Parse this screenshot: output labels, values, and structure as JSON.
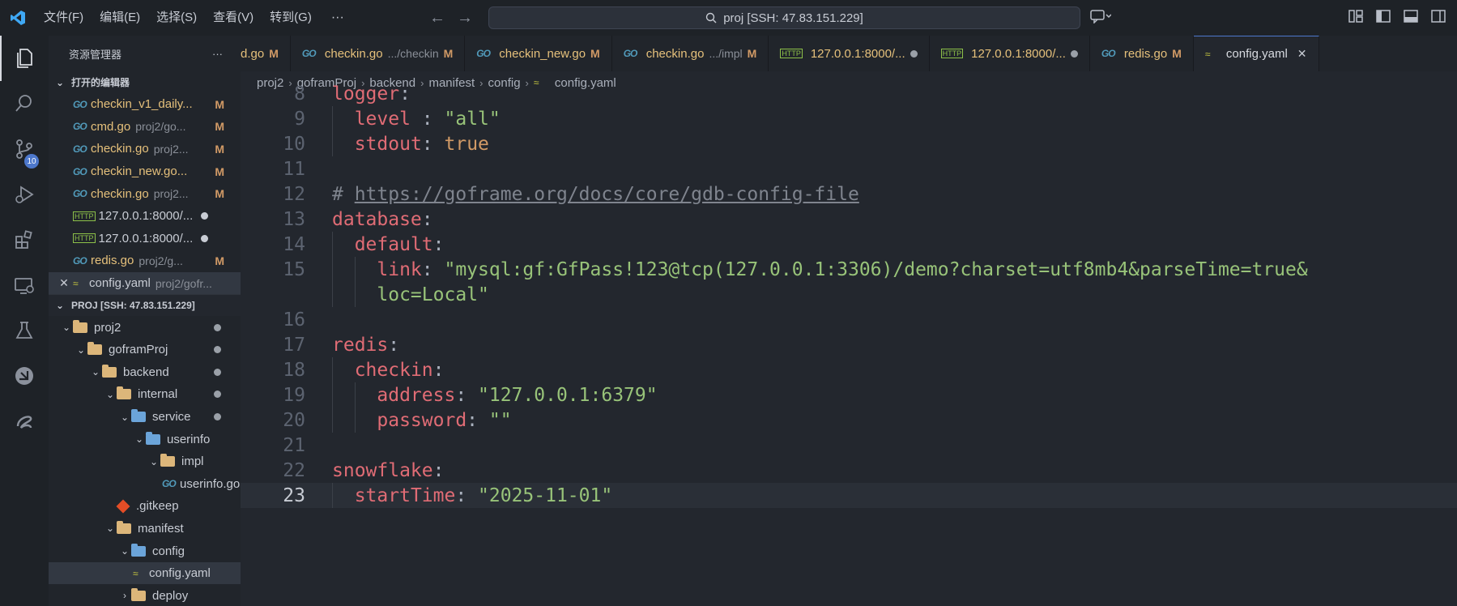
{
  "titlebar": {
    "menu": [
      "文件(F)",
      "编辑(E)",
      "选择(S)",
      "查看(V)",
      "转到(G)"
    ],
    "more": "···",
    "search_text": "proj [SSH: 47.83.151.229]"
  },
  "activitybar": {
    "items": [
      "explorer-icon",
      "search-icon",
      "source-control-icon",
      "run-debug-icon",
      "extensions-icon",
      "remote-explorer-icon",
      "testing-icon",
      "gitlens-icon",
      "copilot-icon"
    ],
    "scm_badge": "10"
  },
  "sidebar": {
    "title": "资源管理器",
    "more": "···",
    "open_editors_label": "打开的编辑器",
    "open_editors": [
      {
        "icon": "go",
        "name": "checkin_v1_daily...",
        "path": "",
        "status": "M"
      },
      {
        "icon": "go",
        "name": "cmd.go",
        "path": "proj2/go...",
        "status": "M"
      },
      {
        "icon": "go",
        "name": "checkin.go",
        "path": "proj2...",
        "status": "M"
      },
      {
        "icon": "go",
        "name": "checkin_new.go...",
        "path": "",
        "status": "M"
      },
      {
        "icon": "go",
        "name": "checkin.go",
        "path": "proj2...",
        "status": "M"
      },
      {
        "icon": "http",
        "name": "127.0.0.1:8000/...",
        "path": "",
        "status": "dot"
      },
      {
        "icon": "http",
        "name": "127.0.0.1:8000/...",
        "path": "",
        "status": "dot"
      },
      {
        "icon": "go",
        "name": "redis.go",
        "path": "proj2/g...",
        "status": "M"
      },
      {
        "icon": "yaml",
        "name": "config.yaml",
        "path": "proj2/gofr...",
        "status": "close"
      }
    ],
    "project_label": "PROJ [SSH: 47.83.151.229]",
    "tree": [
      {
        "type": "folder",
        "name": "proj2",
        "depth": 0,
        "dot": true
      },
      {
        "type": "folder",
        "name": "goframProj",
        "depth": 1,
        "dot": true
      },
      {
        "type": "folder",
        "name": "backend",
        "depth": 2,
        "dot": true
      },
      {
        "type": "folder",
        "name": "internal",
        "depth": 3,
        "dot": true
      },
      {
        "type": "folder-blue",
        "name": "service",
        "depth": 4,
        "dot": true
      },
      {
        "type": "folder-blue",
        "name": "userinfo",
        "depth": 5,
        "dot": false
      },
      {
        "type": "folder",
        "name": "impl",
        "depth": 6,
        "dot": false
      },
      {
        "type": "go",
        "name": "userinfo.go",
        "depth": 7,
        "dot": false
      },
      {
        "type": "git",
        "name": ".gitkeep",
        "depth": 4,
        "dot": false
      },
      {
        "type": "folder",
        "name": "manifest",
        "depth": 3,
        "dot": false
      },
      {
        "type": "folder-blue",
        "name": "config",
        "depth": 4,
        "dot": false
      },
      {
        "type": "yaml",
        "name": "config.yaml",
        "depth": 5,
        "dot": false
      },
      {
        "type": "folder-closed",
        "name": "deploy",
        "depth": 4,
        "dot": false
      }
    ]
  },
  "tabs": [
    {
      "icon": "",
      "name": "d.go",
      "path": "",
      "status": "M"
    },
    {
      "icon": "go",
      "name": "checkin.go",
      "path": ".../checkin",
      "status": "M"
    },
    {
      "icon": "go",
      "name": "checkin_new.go",
      "path": "",
      "status": "M"
    },
    {
      "icon": "go",
      "name": "checkin.go",
      "path": ".../impl",
      "status": "M"
    },
    {
      "icon": "http",
      "name": "127.0.0.1:8000/...",
      "path": "",
      "status": "dot"
    },
    {
      "icon": "http",
      "name": "127.0.0.1:8000/...",
      "path": "",
      "status": "dot"
    },
    {
      "icon": "go",
      "name": "redis.go",
      "path": "",
      "status": "M"
    },
    {
      "icon": "yaml",
      "name": "config.yaml",
      "path": "",
      "status": "close"
    }
  ],
  "breadcrumb": [
    "proj2",
    "goframProj",
    "backend",
    "manifest",
    "config",
    "config.yaml"
  ],
  "editor": {
    "current_line": "23",
    "lines": [
      {
        "n": "8",
        "tokens": [
          [
            "k",
            "logger"
          ],
          [
            "p",
            ":"
          ]
        ]
      },
      {
        "n": "9",
        "tokens": [
          [
            "p",
            "  "
          ],
          [
            "k",
            "level"
          ],
          [
            "p",
            " : "
          ],
          [
            "s",
            "\"all\""
          ]
        ]
      },
      {
        "n": "10",
        "tokens": [
          [
            "p",
            "  "
          ],
          [
            "k",
            "stdout"
          ],
          [
            "p",
            ": "
          ],
          [
            "b",
            "true"
          ]
        ]
      },
      {
        "n": "11",
        "tokens": []
      },
      {
        "n": "12",
        "tokens": [
          [
            "c",
            "# "
          ],
          [
            "u",
            "https://goframe.org/docs/core/gdb-config-file"
          ]
        ]
      },
      {
        "n": "13",
        "tokens": [
          [
            "k",
            "database"
          ],
          [
            "p",
            ":"
          ]
        ]
      },
      {
        "n": "14",
        "tokens": [
          [
            "p",
            "  "
          ],
          [
            "k",
            "default"
          ],
          [
            "p",
            ":"
          ]
        ]
      },
      {
        "n": "15",
        "tokens": [
          [
            "p",
            "    "
          ],
          [
            "k",
            "link"
          ],
          [
            "p",
            ": "
          ],
          [
            "s",
            "\"mysql:gf:GfPass!123@tcp(127.0.0.1:3306)/demo?charset=utf8mb4&parseTime=true&"
          ]
        ]
      },
      {
        "n": "",
        "tokens": [
          [
            "p",
            "    "
          ],
          [
            "s",
            "loc=Local\""
          ]
        ]
      },
      {
        "n": "16",
        "tokens": []
      },
      {
        "n": "17",
        "tokens": [
          [
            "k",
            "redis"
          ],
          [
            "p",
            ":"
          ]
        ]
      },
      {
        "n": "18",
        "tokens": [
          [
            "p",
            "  "
          ],
          [
            "k",
            "checkin"
          ],
          [
            "p",
            ":"
          ]
        ]
      },
      {
        "n": "19",
        "tokens": [
          [
            "p",
            "    "
          ],
          [
            "k",
            "address"
          ],
          [
            "p",
            ": "
          ],
          [
            "s",
            "\"127.0.0.1:6379\""
          ]
        ]
      },
      {
        "n": "20",
        "tokens": [
          [
            "p",
            "    "
          ],
          [
            "k",
            "password"
          ],
          [
            "p",
            ": "
          ],
          [
            "s",
            "\"\""
          ]
        ]
      },
      {
        "n": "21",
        "tokens": []
      },
      {
        "n": "22",
        "tokens": [
          [
            "k",
            "snowflake"
          ],
          [
            "p",
            ":"
          ]
        ]
      },
      {
        "n": "23",
        "tokens": [
          [
            "p",
            "  "
          ],
          [
            "k",
            "startTime"
          ],
          [
            "p",
            ": "
          ],
          [
            "s",
            "\"2025-11-01\""
          ]
        ]
      }
    ]
  },
  "colors": {
    "accent": "#4d78cc",
    "modified": "#d19a66",
    "key": "#e06c75",
    "string": "#98c379",
    "bool": "#d19a66"
  }
}
